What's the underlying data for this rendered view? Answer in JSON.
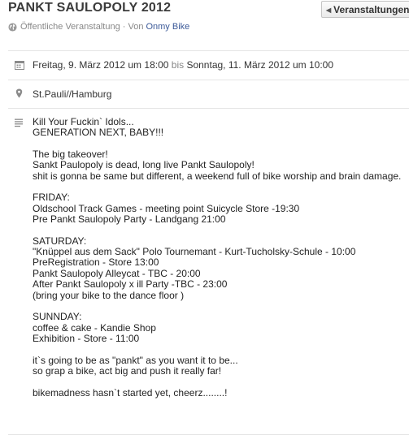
{
  "event": {
    "title": "PANKT SAULOPOLY 2012",
    "back_button_label": "Veranstaltungen",
    "visibility": "Öffentliche Veranstaltung · Von",
    "host": "Onmy Bike",
    "date_start": "Freitag, 9. März 2012 um 18:00",
    "date_connector": "bis",
    "date_end": "Sonntag, 11. März 2012 um 10:00",
    "location": "St.Pauli//Hamburg",
    "description": "Kill Your Fuckin` Idols...\nGENERATION NEXT, BABY!!!\n\nThe big takeover!\nSankt Paulopoly is dead, long live Pankt Saulopoly!\nshit is gonna be same but different, a weekend full of bike worship and brain damage.\n\nFRIDAY:\nOldschool Track Games - meeting point Suicycle Store -19:30\nPre Pankt Saulopoly Party - Landgang 21:00\n\nSATURDAY:\n\"Knüppel aus dem Sack\" Polo Tournemant - Kurt-Tucholsky-Schule - 10:00\nPreRegistration - Store 13:00\nPankt Saulopoly Alleycat - TBC - 20:00\nAfter Pankt Saulopoly x ill Party -TBC - 23:00\n(bring your bike to the dance floor )\n\nSUNNDAY:\ncoffee & cake - Kandie Shop\nExhibition - Store - 11:00\n\nit`s going to be as \"pankt\" as you want it to be...\nso grap a bike, act big and push it really far!\n\nbikemadness hasn`t started yet, cheerz........!"
  },
  "icons": {
    "visibility": "globe-icon",
    "date": "calendar-icon",
    "location": "map-pin-icon",
    "description": "lines-icon",
    "back": "chevron-left-icon"
  },
  "colors": {
    "link": "#3b5998",
    "muted": "#888888",
    "divider": "#e5e5e5"
  }
}
